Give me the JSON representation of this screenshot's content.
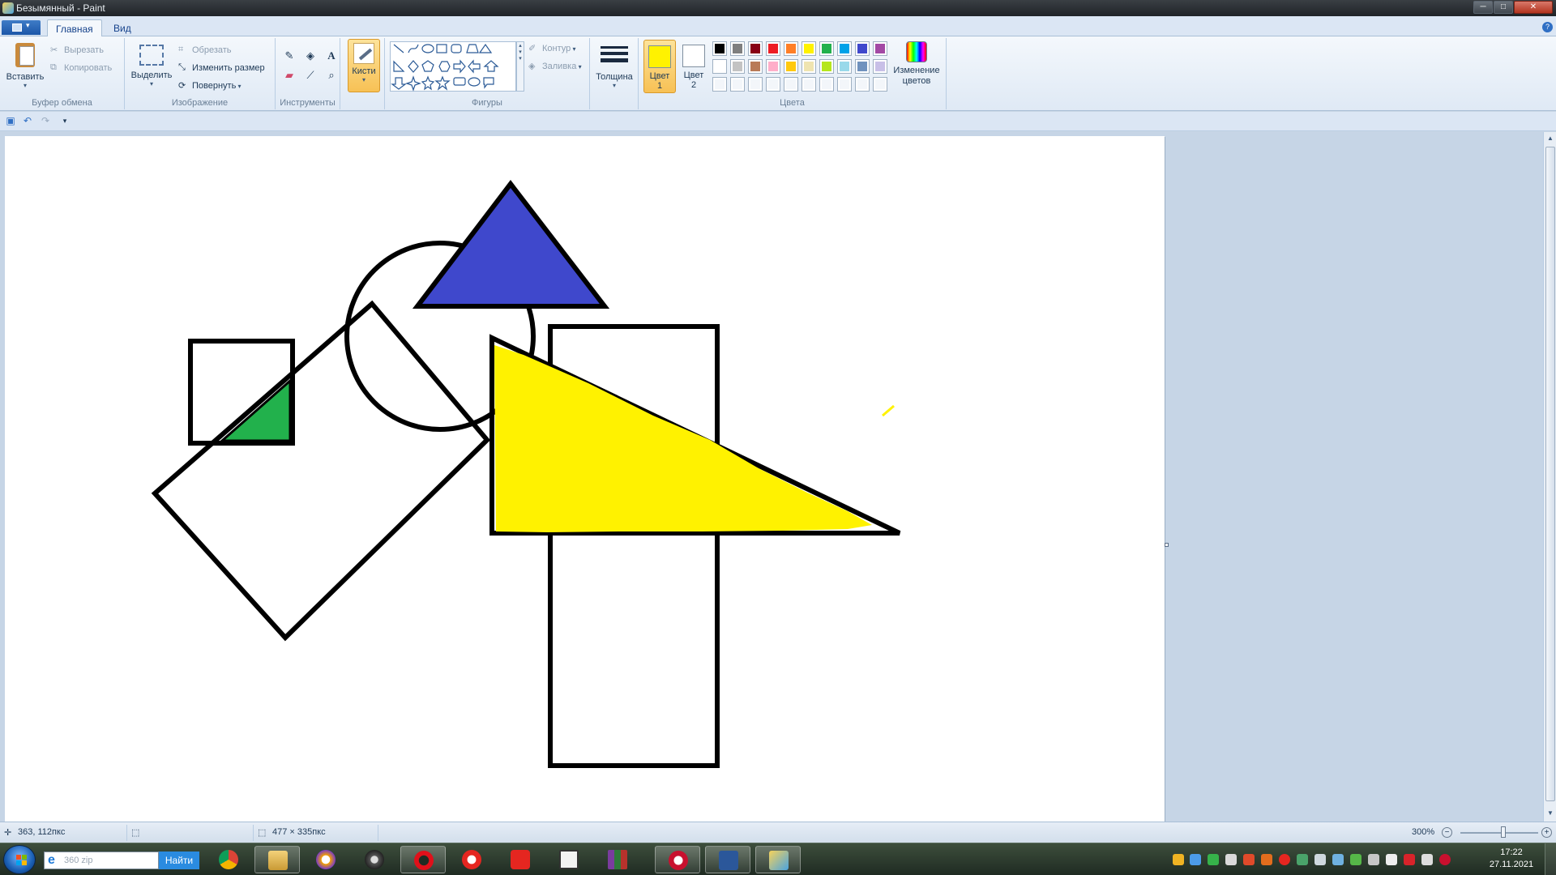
{
  "window": {
    "title": "Безымянный - Paint",
    "min_label": "─",
    "max_label": "□",
    "close_label": "✕"
  },
  "tabs": {
    "file_caret": "▾",
    "home": "Главная",
    "view": "Вид",
    "help": "?"
  },
  "ribbon": {
    "clipboard": {
      "label": "Буфер обмена",
      "paste": "Вставить",
      "cut": "Вырезать",
      "copy": "Копировать"
    },
    "image": {
      "label": "Изображение",
      "select": "Выделить",
      "crop": "Обрезать",
      "resize": "Изменить размер",
      "rotate": "Повернуть"
    },
    "tools": {
      "label": "Инструменты",
      "text_tool": "A"
    },
    "brushes": "Кисти",
    "shapes": {
      "label": "Фигуры",
      "outline": "Контур",
      "fill": "Заливка"
    },
    "size": "Толщина",
    "colors": {
      "label": "Цвета",
      "color1_label": "Цвет",
      "color1_num": "1",
      "color1": "#fff200",
      "color2_label": "Цвет",
      "color2_num": "2",
      "color2": "#ffffff",
      "edit_line1": "Изменение",
      "edit_line2": "цветов",
      "palette": [
        "#000000",
        "#7f7f7f",
        "#880015",
        "#ed1c24",
        "#ff7f27",
        "#fff200",
        "#22b14c",
        "#00a2e8",
        "#3f48cc",
        "#a349a4",
        "#ffffff",
        "#c3c3c3",
        "#b97a57",
        "#ffaec9",
        "#ffc90e",
        "#efe4b0",
        "#b5e61d",
        "#99d9ea",
        "#7092be",
        "#c8bfe7",
        "",
        "",
        "",
        "",
        "",
        "",
        "",
        "",
        "",
        ""
      ]
    }
  },
  "canvas": {
    "accent_colors": {
      "blue": "#3f48cc",
      "yellow": "#fff200",
      "green": "#22b14c",
      "stroke": "#000000"
    }
  },
  "status": {
    "cursor_pos": "363, 112пкс",
    "image_size": "477 × 335пкс",
    "zoom": "300%"
  },
  "taskbar": {
    "search_placeholder": "360 zip",
    "search_button": "Найти",
    "time": "17:22",
    "date": "27.11.2021"
  }
}
